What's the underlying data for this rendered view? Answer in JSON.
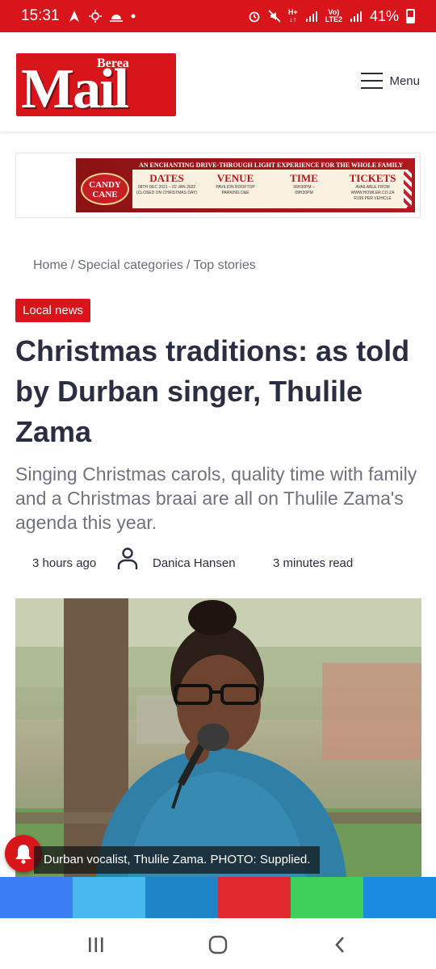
{
  "status_bar": {
    "time": "15:31",
    "battery": "41%",
    "network_top": "Vo)",
    "network_bottom": "LTE2",
    "hplus_top": "H+",
    "hplus_bottom": "↓↑"
  },
  "header": {
    "logo_small": "Berea",
    "logo_large": "Mail",
    "menu_label": "Menu"
  },
  "ad": {
    "headline": "AN ENCHANTING DRIVE-THROUGH LIGHT EXPERIENCE FOR THE WHOLE FAMILY",
    "brand_line1": "CANDY",
    "brand_line2": "CANE",
    "columns": [
      {
        "title": "DATES",
        "sub1": "08TH DEC 2021 – 02 JAN 2022",
        "sub2": "(CLOSED ON CHRISTMAS DAY)"
      },
      {
        "title": "VENUE",
        "sub1": "PAVILION ROOFTOP",
        "sub2": "PARKING D&E"
      },
      {
        "title": "TIME",
        "sub1": "06H30PM –",
        "sub2": "09H30PM"
      },
      {
        "title": "TICKETS",
        "sub1": "AVAILABLE FROM WWW.HOWLER.CO.ZA",
        "sub2": "R199 PER VEHICLE"
      }
    ]
  },
  "breadcrumb": {
    "items": [
      "Home",
      "Special categories",
      "Top stories"
    ],
    "separator": "/"
  },
  "article": {
    "category": "Local news",
    "title": "Christmas traditions: as told by Durban singer, Thulile Zama",
    "lead": "Singing Christmas carols, quality time with family and a Christmas braai are all on Thulile Zama's agenda this year.",
    "time_ago": "3 hours ago",
    "author": "Danica Hansen",
    "read_time": "3 minutes read",
    "image_caption": "Durban vocalist, Thulile Zama. PHOTO: Supplied."
  },
  "share_bar": {
    "colors": [
      "#3b7df3",
      "#49b8f0",
      "#1e86c8",
      "#e0282e",
      "#3ecf5b",
      "#1a8be0"
    ],
    "icons": [
      "facebook-icon",
      "twitter-icon",
      "linkedin-icon",
      "pinterest-icon",
      "whatsapp-icon",
      "telegram-icon"
    ]
  },
  "colors": {
    "brand_red": "#d7151b",
    "headline_text": "#2b2d42",
    "muted_text": "#707280"
  }
}
